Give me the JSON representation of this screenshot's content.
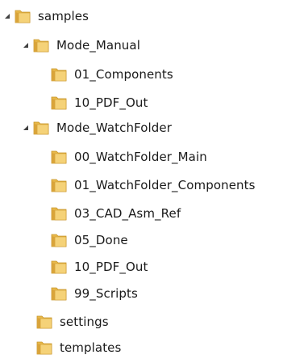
{
  "tree": {
    "nodes": [
      {
        "label": "samples",
        "expanded": true
      },
      {
        "label": "Mode_Manual",
        "expanded": true
      },
      {
        "label": "01_Components"
      },
      {
        "label": "10_PDF_Out"
      },
      {
        "label": "Mode_WatchFolder",
        "expanded": true
      },
      {
        "label": "00_WatchFolder_Main"
      },
      {
        "label": "01_WatchFolder_Components"
      },
      {
        "label": "03_CAD_Asm_Ref"
      },
      {
        "label": "05_Done"
      },
      {
        "label": "10_PDF_Out"
      },
      {
        "label": "99_Scripts"
      },
      {
        "label": "settings"
      },
      {
        "label": "templates"
      }
    ],
    "icons": {
      "folder": "folder-icon",
      "expander": "expanded-triangle-icon"
    },
    "colors": {
      "folder_body": "#E8B84A",
      "folder_front": "#F5D278",
      "folder_edge": "#C9962B",
      "expander": "#404040"
    }
  }
}
